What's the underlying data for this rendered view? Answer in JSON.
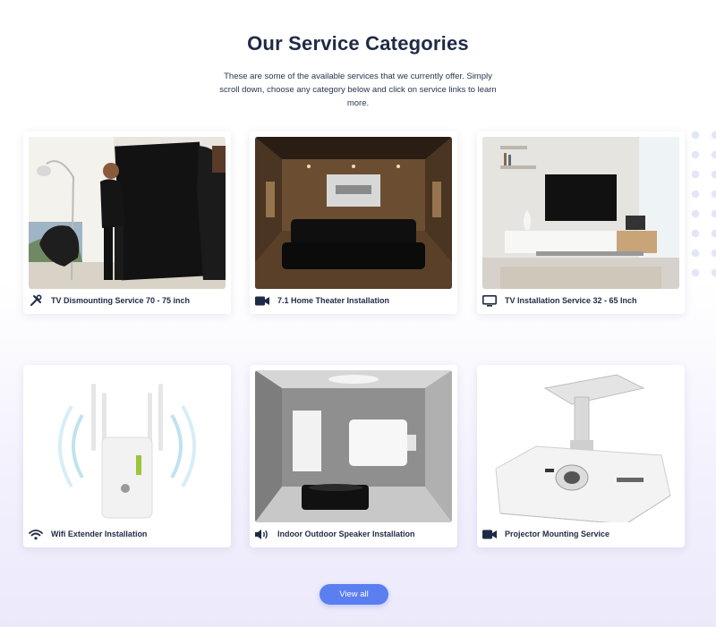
{
  "section": {
    "title": "Our Service Categories",
    "description": "These are some of the available services that we currently offer. Simply scroll down, choose any category below and click on service links to learn more."
  },
  "categories": [
    {
      "label": "TV Dismounting Service 70 - 75 inch",
      "icon": "tools-icon",
      "image": "men-carrying-tv-photo"
    },
    {
      "label": "7.1 Home Theater Installation",
      "icon": "video-camera-icon",
      "image": "home-theater-room-photo"
    },
    {
      "label": "TV Installation Service 32 - 65 Inch",
      "icon": "monitor-icon",
      "image": "living-room-tv-photo"
    },
    {
      "label": "Wifi Extender Installation",
      "icon": "wifi-icon",
      "image": "wifi-extender-photo"
    },
    {
      "label": "Indoor Outdoor Speaker Installation",
      "icon": "speaker-icon",
      "image": "speaker-room-photo"
    },
    {
      "label": "Projector Mounting Service",
      "icon": "video-camera-icon",
      "image": "ceiling-projector-photo"
    }
  ],
  "view_all_label": "View all",
  "colors": {
    "heading": "#1f2a44",
    "button": "#5b7ff0",
    "card": "#ffffff",
    "background_bottom": "#ece9fb"
  }
}
